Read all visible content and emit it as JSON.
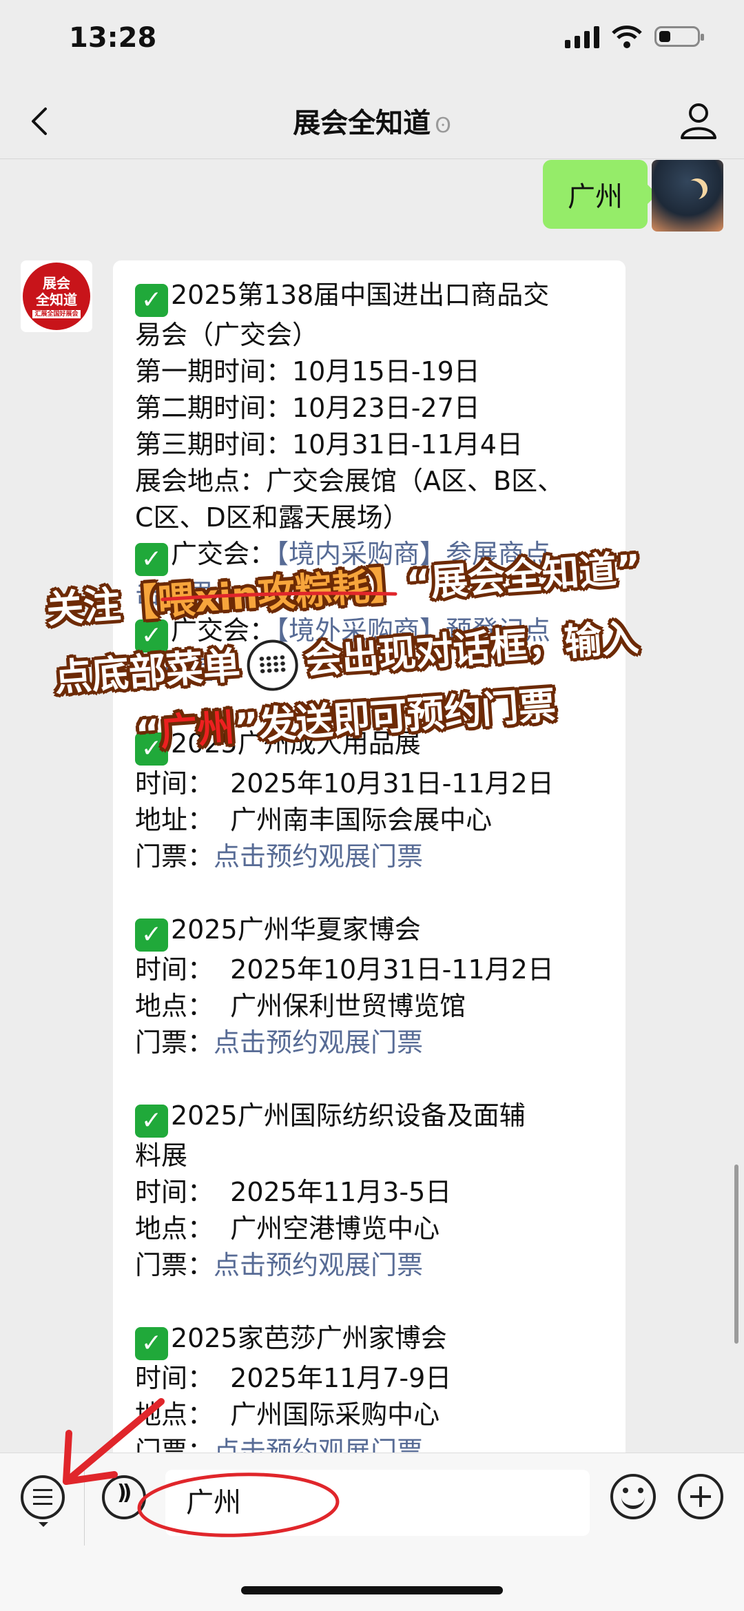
{
  "status_bar": {
    "time": "13:28"
  },
  "nav": {
    "title": "展会全知道",
    "ear_glyph": "ʘ"
  },
  "chat": {
    "my_message": "广州",
    "bot_avatar_text": [
      "展会",
      "全知道",
      "汇展全国好展会"
    ],
    "reply_lines": [
      "2025第138届中国进出口商品交",
      "易会（广交会）",
      "第一期时间：10月15日-19日",
      "第二期时间：10月23日-27日",
      "第三期时间：10月31日-11月4日",
      "展会地点：广交会展馆（A区、B区、",
      "C区、D区和露天展场）"
    ],
    "canton_links": [
      {
        "prefix": "广交会：",
        "link": "【境内采购商】参展商点",
        "tail": "击这里"
      },
      {
        "prefix": "广交会：",
        "link": "【境外采购商】预登记点",
        "tail": "击这里"
      }
    ],
    "exhibitions": [
      {
        "title": "2025广州成人用品展",
        "time": "时间：  2025年10月31日-11月2日",
        "place": "地址：  广州南丰国际会展中心",
        "ticket_label": "门票：",
        "ticket_link": "点击预约观展门票"
      },
      {
        "title": "2025广州华夏家博会",
        "time": "时间：  2025年10月31日-11月2日",
        "place": "地点：  广州保利世贸博览馆",
        "ticket_label": "门票：",
        "ticket_link": "点击预约观展门票"
      },
      {
        "title": "2025广州国际纺织设备及面辅",
        "title2": "料展",
        "time": "时间：  2025年11月3-5日",
        "place": "地点：  广州空港博览中心",
        "ticket_label": "门票：",
        "ticket_link": "点击预约观展门票"
      },
      {
        "title": "2025家芭莎广州家博会",
        "time": "时间：  2025年11月7-9日",
        "place": "地点：  广州国际采购中心",
        "ticket_label": "门票：",
        "ticket_link": "点击预约观展门票"
      }
    ]
  },
  "overlay": {
    "line1_a": "关注",
    "line1_b": "【喂xin攻粽耗】",
    "line1_c": "“展会全知道”",
    "line2_a": "点底部菜单",
    "line2_b": "会出现对话框，输入",
    "line3_a": "“",
    "line3_b": "广州",
    "line3_c": "”发送即可预约门票"
  },
  "input_bar": {
    "value": "广州"
  },
  "colors": {
    "bubble_mine": "#95ec69",
    "link": "#576b95",
    "check": "#20a93a",
    "annot": "#e0262b"
  }
}
